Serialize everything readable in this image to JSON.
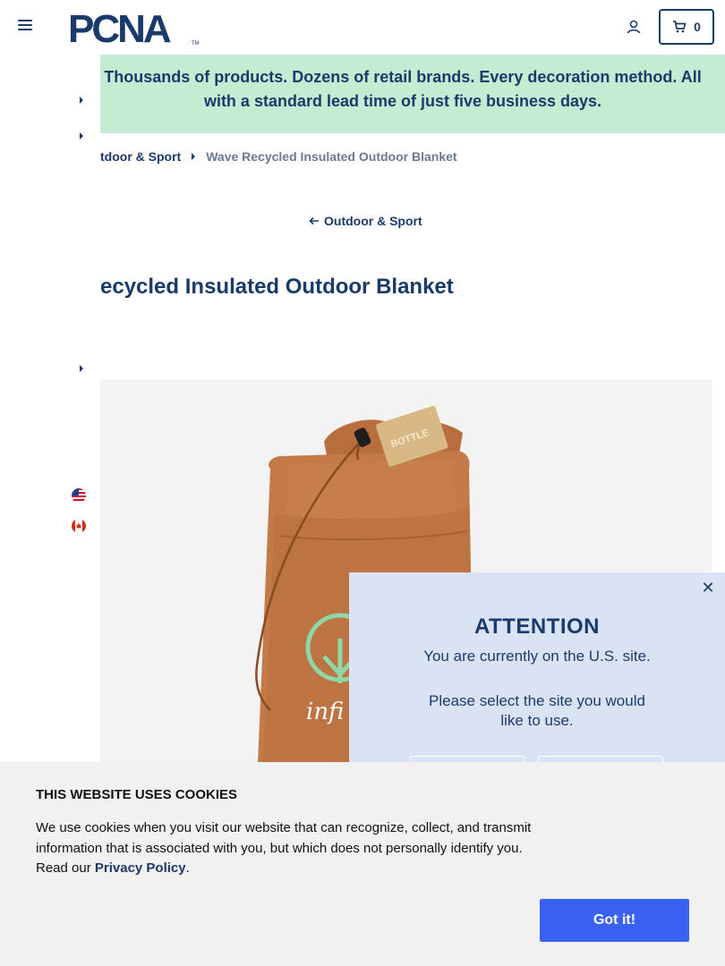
{
  "header": {
    "logo_text": "PCNA",
    "cart_count": "0"
  },
  "banner": {
    "text": "Thousands of products. Dozens of retail brands. Every decoration method. All with a standard lead time of just five business days."
  },
  "breadcrumb": {
    "parent": "tdoor & Sport",
    "current": "Wave Recycled Insulated Outdoor Blanket"
  },
  "back_link": {
    "label": "Outdoor & Sport"
  },
  "product": {
    "title": "ecycled Insulated Outdoor Blanket",
    "image_alt": "Wave Recycled Insulated Outdoor Blanket",
    "tag_text": "BOTTLE",
    "print_text": "infi"
  },
  "modal": {
    "heading": "ATTENTION",
    "line1": "You are currently on the U.S. site.",
    "line2": "Please select the site you would like to use."
  },
  "cookie": {
    "title": "THIS WEBSITE USES COOKIES",
    "text": "We use cookies when you visit our website that can recognize, collect, and transmit information that is associated with you, but which does not personally identify you. Read our ",
    "link_label": "Privacy Policy",
    "suffix": ".",
    "button_label": "Got it!"
  },
  "colors": {
    "brand_blue": "#1a3a6b",
    "banner_green": "#c4ecd2",
    "modal_bg": "#d9e3f4",
    "cookie_button": "#3a62f2",
    "bag_orange": "#c47a47"
  }
}
